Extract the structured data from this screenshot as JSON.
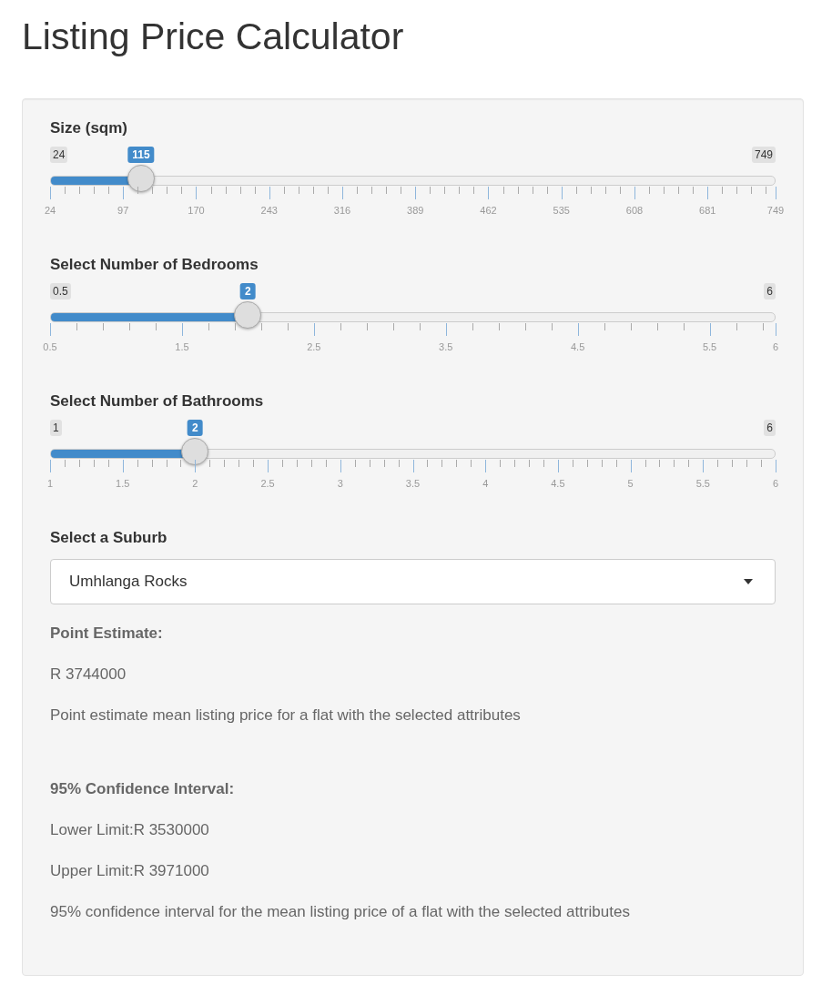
{
  "title": "Listing Price Calculator",
  "sliders": [
    {
      "label": "Size (sqm)",
      "min": "24",
      "max": "749",
      "value": "115",
      "level": 0.1255,
      "ticks": [
        "24",
        "97",
        "170",
        "243",
        "316",
        "389",
        "462",
        "535",
        "608",
        "681",
        "749"
      ]
    },
    {
      "label": "Select Number of Bedrooms",
      "min": "0.5",
      "max": "6",
      "value": "2",
      "level": 0.2727,
      "ticks": [
        "0.5",
        "1.5",
        "2.5",
        "3.5",
        "4.5",
        "5.5",
        "6"
      ]
    },
    {
      "label": "Select Number of Bathrooms",
      "min": "1",
      "max": "6",
      "value": "2",
      "level": 0.2,
      "ticks": [
        "1",
        "1.5",
        "2",
        "2.5",
        "3",
        "3.5",
        "4",
        "4.5",
        "5",
        "5.5",
        "6"
      ]
    }
  ],
  "suburb": {
    "label": "Select a Suburb",
    "value": "Umhlanga Rocks"
  },
  "results": [
    {
      "kind": "heading",
      "text": "Point Estimate:"
    },
    {
      "kind": "text",
      "text": "R 3744000"
    },
    {
      "kind": "text",
      "text": "Point estimate mean listing price for a flat with the selected attributes"
    },
    {
      "kind": "spacer"
    },
    {
      "kind": "heading",
      "text": "95% Confidence Interval:"
    },
    {
      "kind": "text",
      "text": "Lower Limit:R 3530000"
    },
    {
      "kind": "text",
      "text": "Upper Limit:R 3971000"
    },
    {
      "kind": "text",
      "text": "95% confidence interval for the mean listing price of a flat with the selected attributes"
    }
  ]
}
